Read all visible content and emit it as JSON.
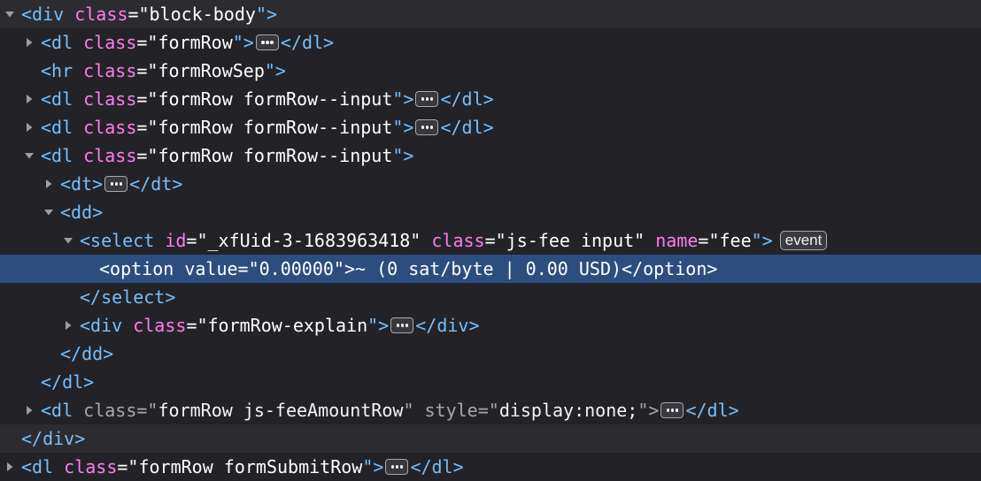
{
  "panel": "inspector-markup-view",
  "icons": {
    "expanded": "triangle-down-icon",
    "collapsed": "triangle-right-icon",
    "collapsed_content": "ellipsis-icon"
  },
  "colors": {
    "background": "#232327",
    "selected_row": "#2c4e7f",
    "tag": "#75bfff",
    "attribute_name": "#ff7de9",
    "attribute_value": "#ffffff",
    "dimmed": "#a7a7ad"
  },
  "nodes": [
    {
      "parts": [
        {
          "k": "tag",
          "t": "<div "
        },
        {
          "k": "attr",
          "t": "class"
        },
        {
          "k": "val",
          "t": "=\"block-body"
        },
        {
          "k": "tag",
          "t": "\">"
        }
      ]
    },
    {
      "parts": [
        {
          "k": "tag",
          "t": "<dl "
        },
        {
          "k": "attr",
          "t": "class"
        },
        {
          "k": "val",
          "t": "=\"formRow"
        },
        {
          "k": "tag",
          "t": "\">"
        },
        {
          "k": "ellipsis"
        },
        {
          "k": "tag",
          "t": "</dl>"
        }
      ]
    },
    {
      "parts": [
        {
          "k": "tag",
          "t": "<hr "
        },
        {
          "k": "attr",
          "t": "class"
        },
        {
          "k": "val",
          "t": "=\"formRowSep"
        },
        {
          "k": "tag",
          "t": "\">"
        }
      ]
    },
    {
      "parts": [
        {
          "k": "tag",
          "t": "<dl "
        },
        {
          "k": "attr",
          "t": "class"
        },
        {
          "k": "val",
          "t": "=\"formRow formRow--input"
        },
        {
          "k": "tag",
          "t": "\">"
        },
        {
          "k": "ellipsis"
        },
        {
          "k": "tag",
          "t": "</dl>"
        }
      ]
    },
    {
      "parts": [
        {
          "k": "tag",
          "t": "<dl "
        },
        {
          "k": "attr",
          "t": "class"
        },
        {
          "k": "val",
          "t": "=\"formRow formRow--input"
        },
        {
          "k": "tag",
          "t": "\">"
        },
        {
          "k": "ellipsis"
        },
        {
          "k": "tag",
          "t": "</dl>"
        }
      ]
    },
    {
      "parts": [
        {
          "k": "tag",
          "t": "<dl "
        },
        {
          "k": "attr",
          "t": "class"
        },
        {
          "k": "val",
          "t": "=\"formRow formRow--input"
        },
        {
          "k": "tag",
          "t": "\">"
        }
      ]
    },
    {
      "parts": [
        {
          "k": "tag",
          "t": "<dt>"
        },
        {
          "k": "ellipsis"
        },
        {
          "k": "tag",
          "t": "</dt>"
        }
      ]
    },
    {
      "parts": [
        {
          "k": "tag",
          "t": "<dd>"
        }
      ]
    },
    {
      "parts": [
        {
          "k": "tag",
          "t": "<select "
        },
        {
          "k": "attr",
          "t": "id"
        },
        {
          "k": "val",
          "t": "=\"_xfUid-3-1683963418\" "
        },
        {
          "k": "attr",
          "t": "class"
        },
        {
          "k": "val",
          "t": "=\"js-fee input\" "
        },
        {
          "k": "attr",
          "t": "name"
        },
        {
          "k": "val",
          "t": "=\"fee"
        },
        {
          "k": "tag",
          "t": "\">"
        },
        {
          "k": "badge",
          "t": "event"
        }
      ]
    },
    {
      "parts": [
        {
          "k": "tag",
          "t": "<option "
        },
        {
          "k": "attr",
          "t": "value"
        },
        {
          "k": "val",
          "t": "=\"0.00000"
        },
        {
          "k": "tag",
          "t": "\">"
        },
        {
          "k": "txt",
          "t": "~ (0 sat/byte | 0.00 USD)"
        },
        {
          "k": "tag",
          "t": "</option>"
        }
      ]
    },
    {
      "parts": [
        {
          "k": "tag",
          "t": "</select>"
        }
      ]
    },
    {
      "parts": [
        {
          "k": "tag",
          "t": "<div "
        },
        {
          "k": "attr",
          "t": "class"
        },
        {
          "k": "val",
          "t": "=\"formRow-explain"
        },
        {
          "k": "tag",
          "t": "\">"
        },
        {
          "k": "ellipsis"
        },
        {
          "k": "tag",
          "t": "</div>"
        }
      ]
    },
    {
      "parts": [
        {
          "k": "tag",
          "t": "</dd>"
        }
      ]
    },
    {
      "parts": [
        {
          "k": "tag",
          "t": "</dl>"
        }
      ]
    },
    {
      "parts": [
        {
          "k": "tag",
          "t": "<dl "
        },
        {
          "k": "dim",
          "t": "class"
        },
        {
          "k": "dim",
          "t": "=\""
        },
        {
          "k": "txt",
          "t": "formRow js-feeAmountRow"
        },
        {
          "k": "dim",
          "t": "\" style=\""
        },
        {
          "k": "txt",
          "t": "display:none;"
        },
        {
          "k": "dim",
          "t": "\">"
        },
        {
          "k": "ellipsis"
        },
        {
          "k": "tag",
          "t": "</dl>"
        }
      ]
    },
    {
      "parts": [
        {
          "k": "tag",
          "t": "</div>"
        }
      ]
    },
    {
      "parts": [
        {
          "k": "tag",
          "t": "<dl "
        },
        {
          "k": "attr",
          "t": "class"
        },
        {
          "k": "val",
          "t": "=\"formRow formSubmitRow"
        },
        {
          "k": "tag",
          "t": "\">"
        },
        {
          "k": "ellipsis"
        },
        {
          "k": "tag",
          "t": "</dl>"
        }
      ]
    }
  ]
}
